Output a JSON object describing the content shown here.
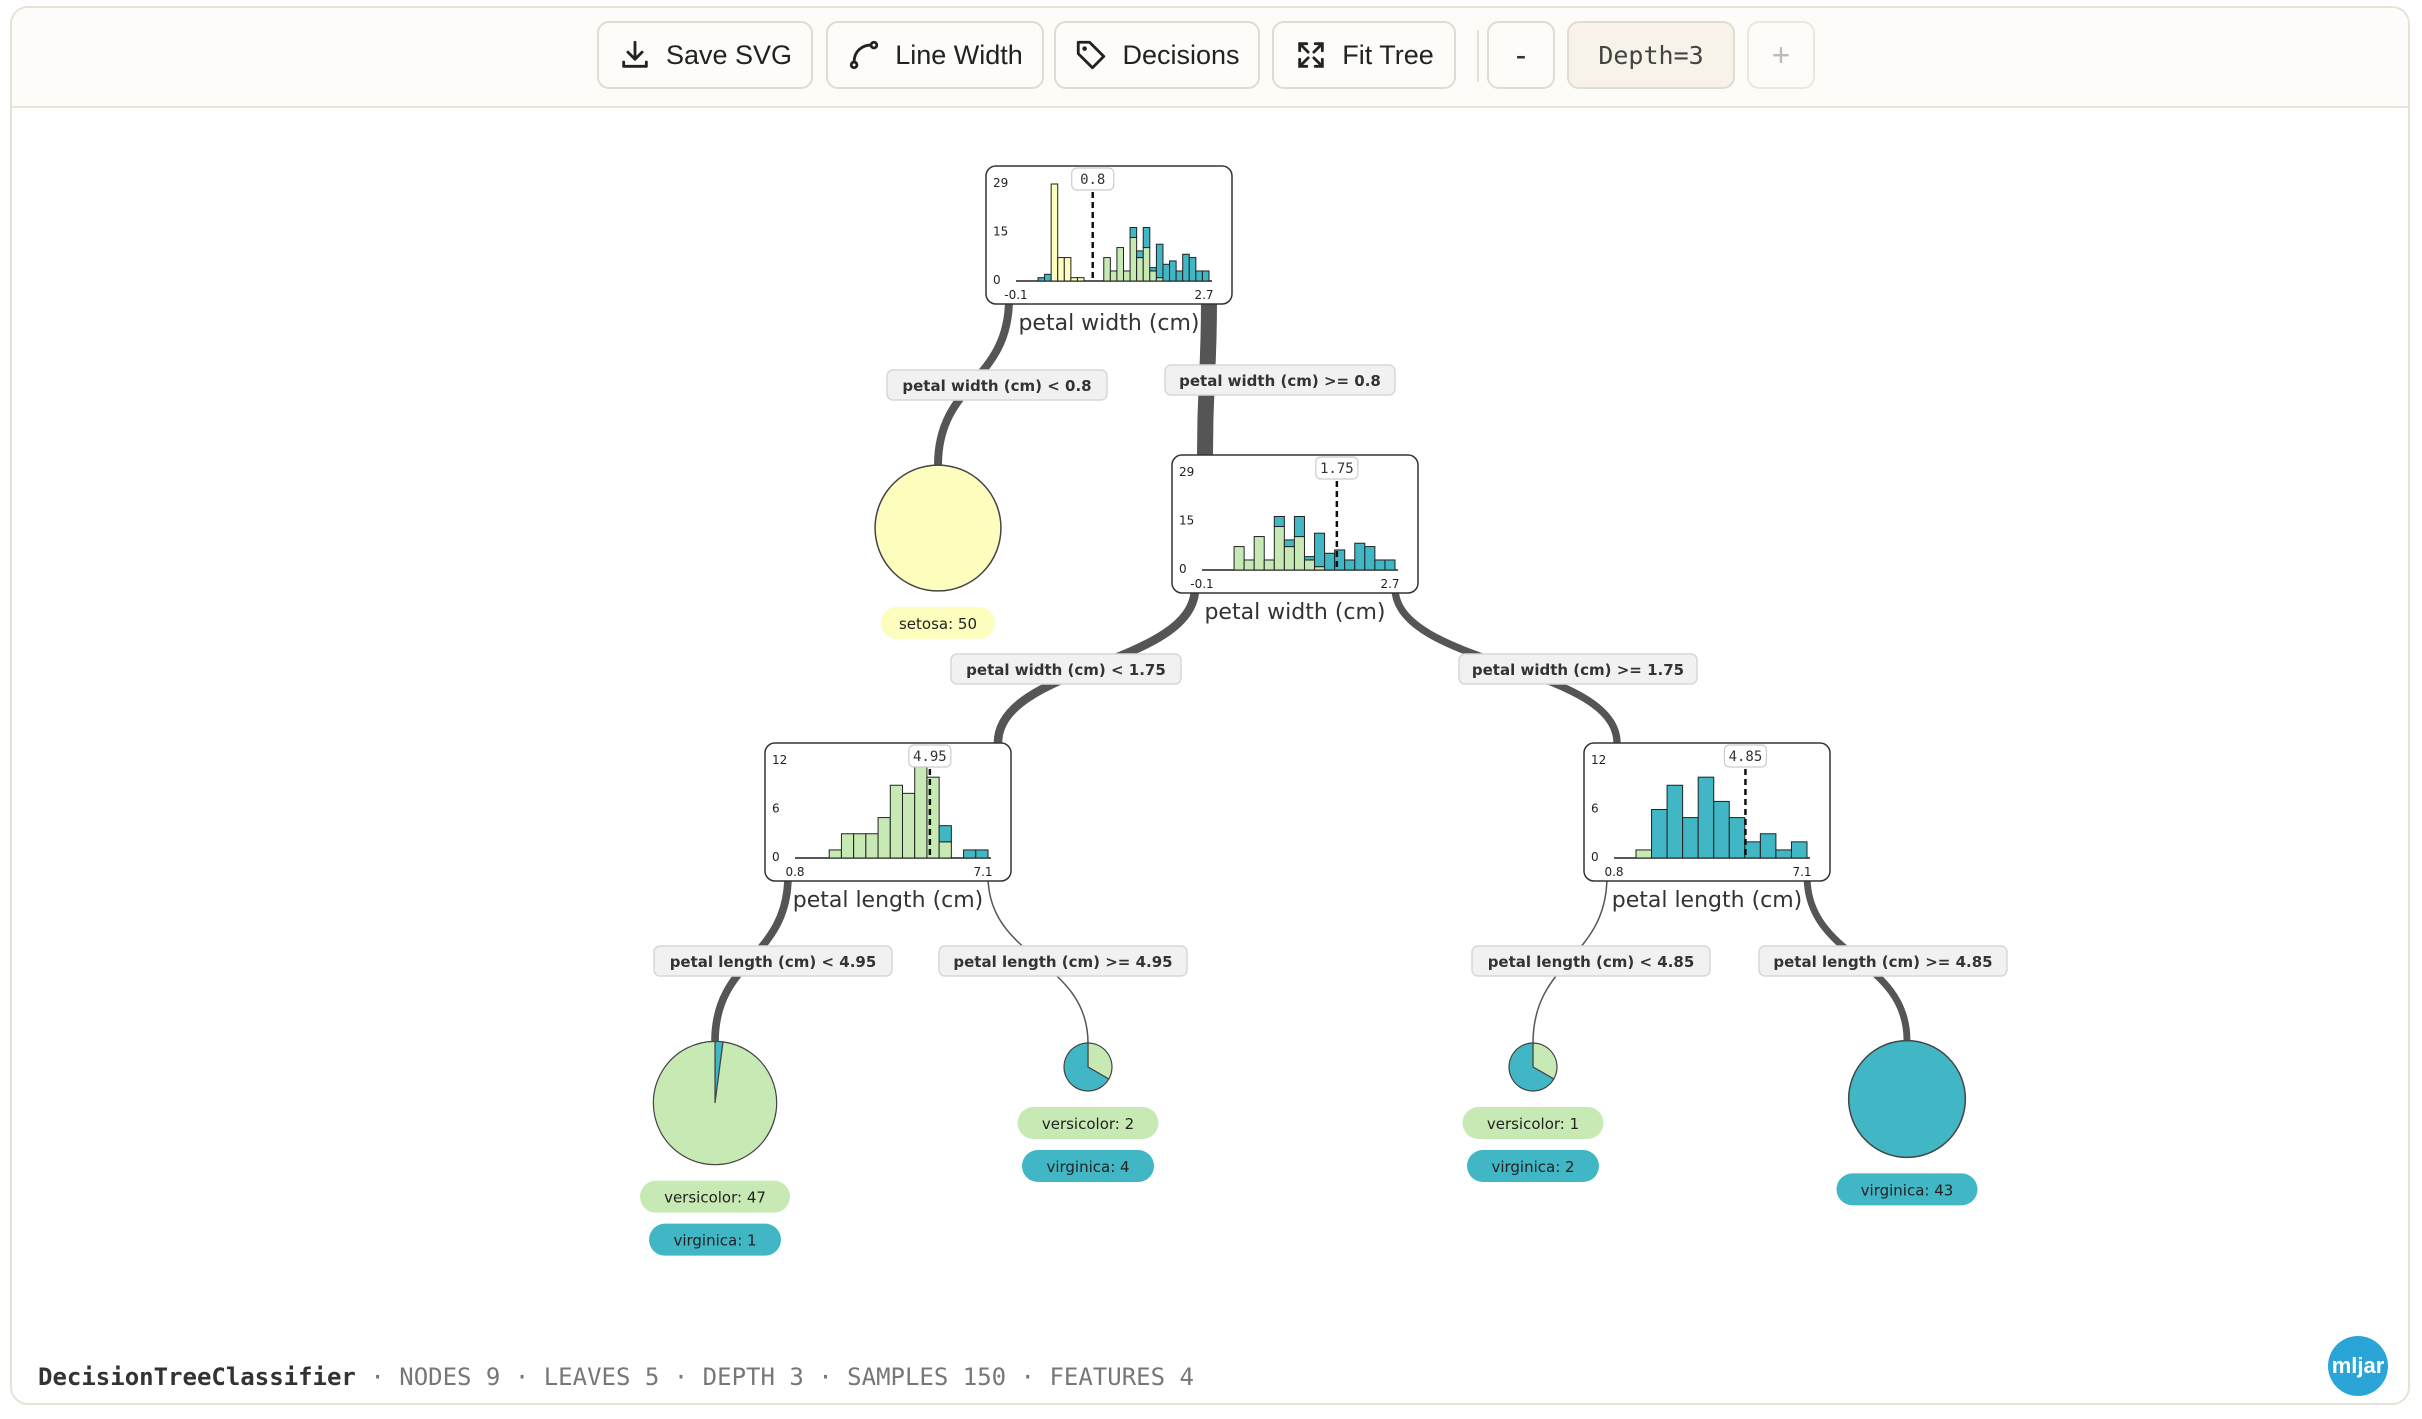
{
  "toolbar": {
    "save_label": "Save SVG",
    "line_width_label": "Line Width",
    "decisions_label": "Decisions",
    "fit_label": "Fit Tree",
    "minus_label": "-",
    "depth_label": "Depth=3",
    "plus_label": "+"
  },
  "colors": {
    "setosa": "#fdfdbd",
    "versicolor": "#c7e9b4",
    "virginica": "#41b6c4",
    "edge": "#555555"
  },
  "tree": {
    "splits": [
      {
        "id": "root",
        "feature": "petal width (cm)",
        "threshold": "0.8",
        "y_ticks": [
          "29",
          "15",
          "0"
        ],
        "x_min": "-0.1",
        "x_max": "2.7",
        "t": 0.32,
        "hist": [
          [
            0,
            0,
            0,
            1
          ],
          [
            0,
            0,
            0,
            2
          ],
          [
            0,
            29,
            0,
            0
          ],
          [
            0,
            7,
            0,
            0
          ],
          [
            0,
            7,
            0,
            0
          ],
          [
            0,
            1,
            0,
            0
          ],
          [
            0,
            1,
            0,
            0
          ],
          [
            0,
            0,
            0,
            0
          ],
          [
            0,
            0,
            0,
            0
          ],
          [
            0,
            0,
            0,
            0
          ],
          [
            0,
            0,
            7,
            0
          ],
          [
            0,
            0,
            3,
            0
          ],
          [
            0,
            0,
            10,
            0
          ],
          [
            0,
            0,
            3,
            0
          ],
          [
            0,
            0,
            13,
            3
          ],
          [
            0,
            0,
            7,
            2
          ],
          [
            0,
            0,
            10,
            6
          ],
          [
            0,
            0,
            3,
            1
          ],
          [
            0,
            0,
            1,
            10
          ],
          [
            0,
            0,
            0,
            5
          ],
          [
            0,
            0,
            0,
            6
          ],
          [
            0,
            0,
            0,
            3
          ],
          [
            0,
            0,
            0,
            8
          ],
          [
            0,
            0,
            0,
            7
          ],
          [
            0,
            0,
            0,
            3
          ],
          [
            0,
            0,
            0,
            3
          ]
        ]
      },
      {
        "id": "right",
        "feature": "petal width (cm)",
        "threshold": "1.75",
        "y_ticks": [
          "29",
          "15",
          "0"
        ],
        "x_min": "-0.1",
        "x_max": "2.7",
        "t": 0.66,
        "hist": [
          [
            0,
            0,
            0,
            0
          ],
          [
            0,
            0,
            7,
            0
          ],
          [
            0,
            0,
            3,
            0
          ],
          [
            0,
            0,
            10,
            0
          ],
          [
            0,
            0,
            3,
            0
          ],
          [
            0,
            0,
            13,
            3
          ],
          [
            0,
            0,
            7,
            2
          ],
          [
            0,
            0,
            10,
            6
          ],
          [
            0,
            0,
            3,
            1
          ],
          [
            0,
            0,
            1,
            10
          ],
          [
            0,
            0,
            0,
            5
          ],
          [
            0,
            0,
            0,
            6
          ],
          [
            0,
            0,
            0,
            3
          ],
          [
            0,
            0,
            0,
            8
          ],
          [
            0,
            0,
            0,
            7
          ],
          [
            0,
            0,
            0,
            3
          ],
          [
            0,
            0,
            0,
            3
          ]
        ]
      },
      {
        "id": "ll",
        "feature": "petal length (cm)",
        "threshold": "4.95",
        "y_ticks": [
          "12",
          "6",
          "0"
        ],
        "x_min": "0.8",
        "x_max": "7.1",
        "t": 0.66,
        "hist": [
          [
            0,
            0,
            0,
            0
          ],
          [
            0,
            0,
            1,
            0
          ],
          [
            0,
            0,
            3,
            0
          ],
          [
            0,
            0,
            3,
            0
          ],
          [
            0,
            0,
            3,
            0
          ],
          [
            0,
            0,
            5,
            0
          ],
          [
            0,
            0,
            9,
            0
          ],
          [
            0,
            0,
            8,
            0
          ],
          [
            0,
            0,
            12,
            0
          ],
          [
            0,
            0,
            10,
            0
          ],
          [
            0,
            0,
            2,
            2
          ],
          [
            0,
            0,
            0,
            0
          ],
          [
            0,
            0,
            0,
            1
          ],
          [
            0,
            0,
            0,
            1
          ]
        ]
      },
      {
        "id": "rl",
        "feature": "petal length (cm)",
        "threshold": "4.85",
        "y_ticks": [
          "12",
          "6",
          "0"
        ],
        "x_min": "0.8",
        "x_max": "7.1",
        "t": 0.64,
        "hist": [
          [
            0,
            0,
            1,
            0
          ],
          [
            0,
            0,
            0,
            6
          ],
          [
            0,
            0,
            0,
            9
          ],
          [
            0,
            0,
            0,
            5
          ],
          [
            0,
            0,
            0,
            10
          ],
          [
            0,
            0,
            0,
            7
          ],
          [
            0,
            0,
            0,
            5
          ],
          [
            0,
            0,
            0,
            2
          ],
          [
            0,
            0,
            0,
            3
          ],
          [
            0,
            0,
            0,
            1
          ],
          [
            0,
            0,
            0,
            2
          ]
        ]
      }
    ],
    "edges": [
      {
        "from": "root",
        "to": "setosa",
        "label": "petal width (cm) < 0.8",
        "samples": 50
      },
      {
        "from": "root",
        "to": "right",
        "label": "petal width (cm) >= 0.8",
        "samples": 100
      },
      {
        "from": "right",
        "to": "ll",
        "label": "petal width (cm) < 1.75",
        "samples": 54
      },
      {
        "from": "right",
        "to": "rl",
        "label": "petal width (cm) >= 1.75",
        "samples": 46
      },
      {
        "from": "ll",
        "to": "leaf1",
        "label": "petal length (cm) < 4.95",
        "samples": 48
      },
      {
        "from": "ll",
        "to": "leaf2",
        "label": "petal length (cm) >= 4.95",
        "samples": 6
      },
      {
        "from": "rl",
        "to": "leaf3",
        "label": "petal length (cm) < 4.85",
        "samples": 3
      },
      {
        "from": "rl",
        "to": "leaf4",
        "label": "petal length (cm) >= 4.85",
        "samples": 43
      }
    ],
    "leaves": [
      {
        "id": "setosa",
        "counts": [
          {
            "cls": "setosa",
            "n": 50,
            "label": "setosa: 50"
          }
        ]
      },
      {
        "id": "leaf1",
        "counts": [
          {
            "cls": "versicolor",
            "n": 47,
            "label": "versicolor: 47"
          },
          {
            "cls": "virginica",
            "n": 1,
            "label": "virginica: 1"
          }
        ]
      },
      {
        "id": "leaf2",
        "counts": [
          {
            "cls": "versicolor",
            "n": 2,
            "label": "versicolor: 2"
          },
          {
            "cls": "virginica",
            "n": 4,
            "label": "virginica: 4"
          }
        ]
      },
      {
        "id": "leaf3",
        "counts": [
          {
            "cls": "versicolor",
            "n": 1,
            "label": "versicolor: 1"
          },
          {
            "cls": "virginica",
            "n": 2,
            "label": "virginica: 2"
          }
        ]
      },
      {
        "id": "leaf4",
        "counts": [
          {
            "cls": "virginica",
            "n": 43,
            "label": "virginica: 43"
          }
        ]
      }
    ]
  },
  "footer": {
    "model": "DecisionTreeClassifier",
    "stats": " · NODES 9 · LEAVES 5 · DEPTH 3 · SAMPLES 150 · FEATURES 4"
  },
  "logo_text": "mljar"
}
